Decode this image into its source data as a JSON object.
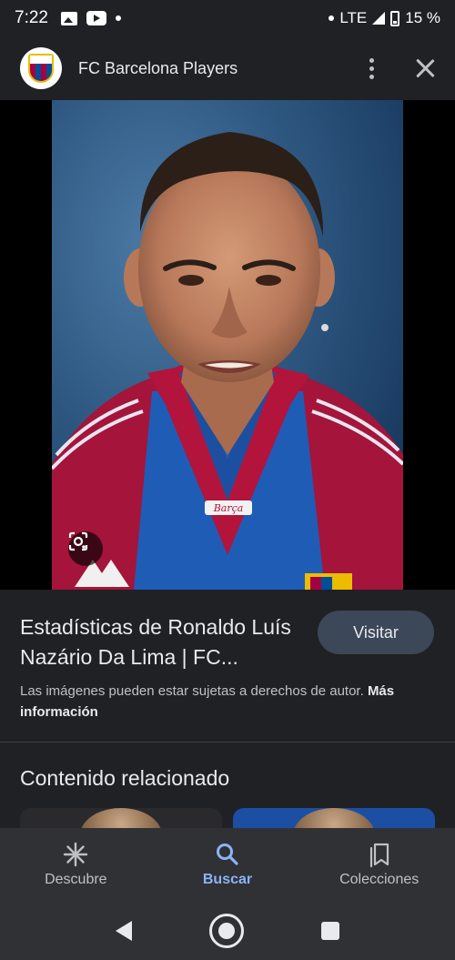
{
  "status_bar": {
    "time": "7:22",
    "network": "LTE",
    "battery": "15 %"
  },
  "header": {
    "title": "FC Barcelona Players",
    "icons": [
      "barcelona-crest",
      "more-vert-icon",
      "close-icon"
    ]
  },
  "image_viewer": {
    "shirt_text": "Barça",
    "lens_icon": "google-lens-icon"
  },
  "result": {
    "title": "Estadísticas de Ronaldo Luís Nazário Da Lima | FC...",
    "visit_label": "Visitar",
    "copyright_text": "Las imágenes pueden estar sujetas a derechos de autor.",
    "more_info_label": "Más información"
  },
  "related": {
    "title": "Contenido relacionado"
  },
  "bottom_nav": {
    "items": [
      {
        "label": "Descubre",
        "icon": "asterisk-icon",
        "active": false
      },
      {
        "label": "Buscar",
        "icon": "search-icon",
        "active": true
      },
      {
        "label": "Colecciones",
        "icon": "bookmarks-icon",
        "active": false
      }
    ]
  },
  "colors": {
    "background": "#202124",
    "accent": "#8ab4f8",
    "visit_button": "#3c4758",
    "barca_blue": "#004d98",
    "barca_red": "#a50044"
  }
}
